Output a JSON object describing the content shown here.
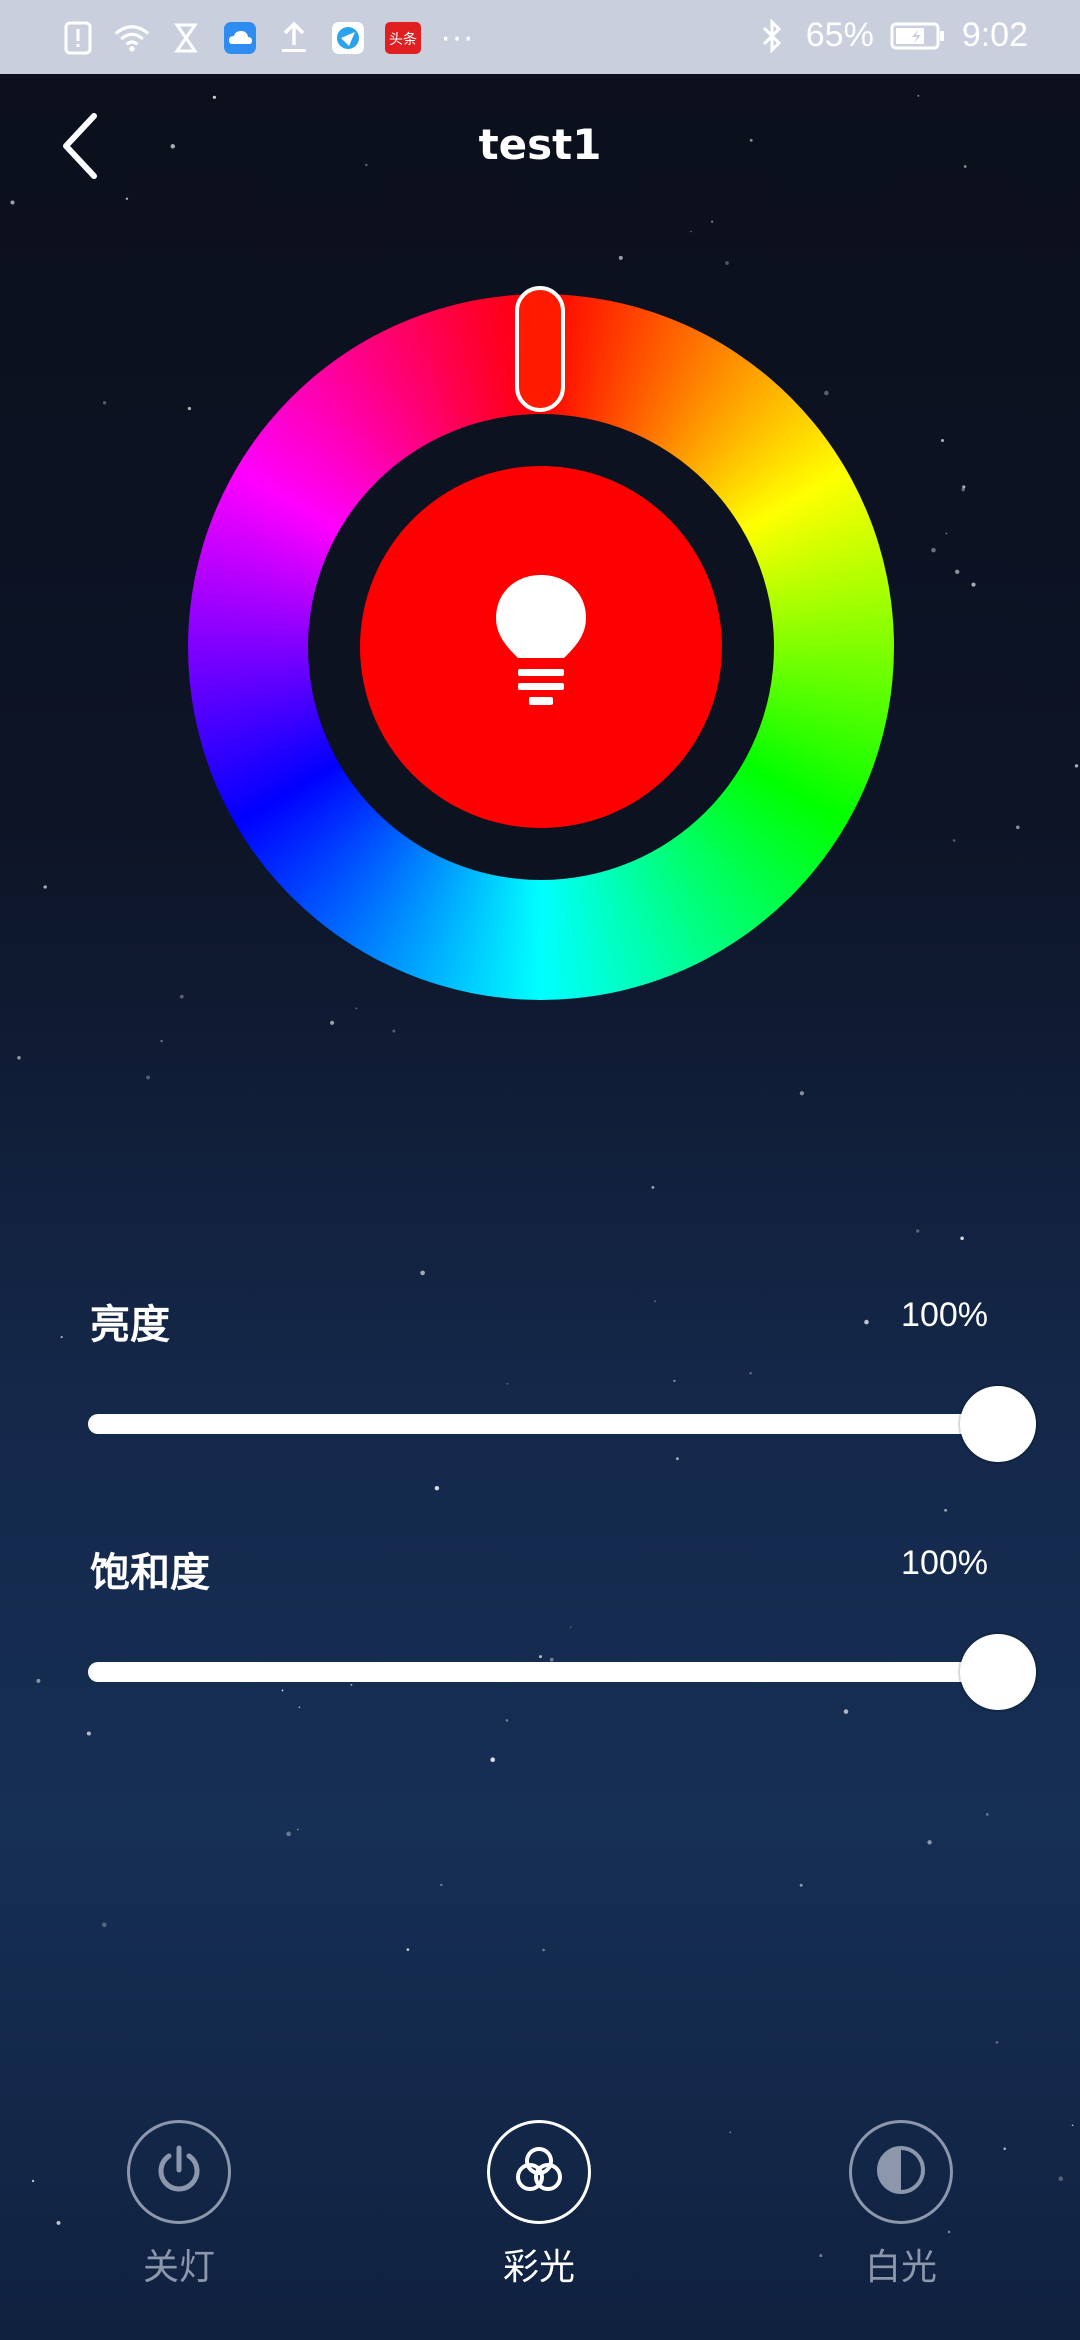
{
  "status_bar": {
    "battery": "65%",
    "time": "9:02",
    "more": "···",
    "news_app_label": "头条",
    "icons": [
      "alert-icon",
      "wifi-icon",
      "hourglass-icon",
      "cloud-app-icon",
      "upload-icon",
      "browser-app-icon",
      "news-app-icon",
      "bluetooth-icon",
      "battery-icon"
    ]
  },
  "header": {
    "title": "test1",
    "back_icon": "back-arrow-icon"
  },
  "color_wheel": {
    "selected_color": "#ff0000",
    "center_icon": "lightbulb-icon"
  },
  "brightness": {
    "label": "亮度",
    "value_text": "100%",
    "value": 100
  },
  "saturation": {
    "label": "饱和度",
    "value_text": "100%",
    "value": 100
  },
  "bottom_nav": {
    "items": [
      {
        "label": "关灯",
        "icon": "power-icon",
        "active": false
      },
      {
        "label": "彩光",
        "icon": "color-circles-icon",
        "active": true
      },
      {
        "label": "白光",
        "icon": "half-circle-icon",
        "active": false
      }
    ]
  },
  "colors": {
    "background_top": "#0b0f1b",
    "background_bottom": "#162f55",
    "status_bar": "#c9cfdc",
    "inactive": "#8c97ab",
    "active": "#ffffff"
  }
}
